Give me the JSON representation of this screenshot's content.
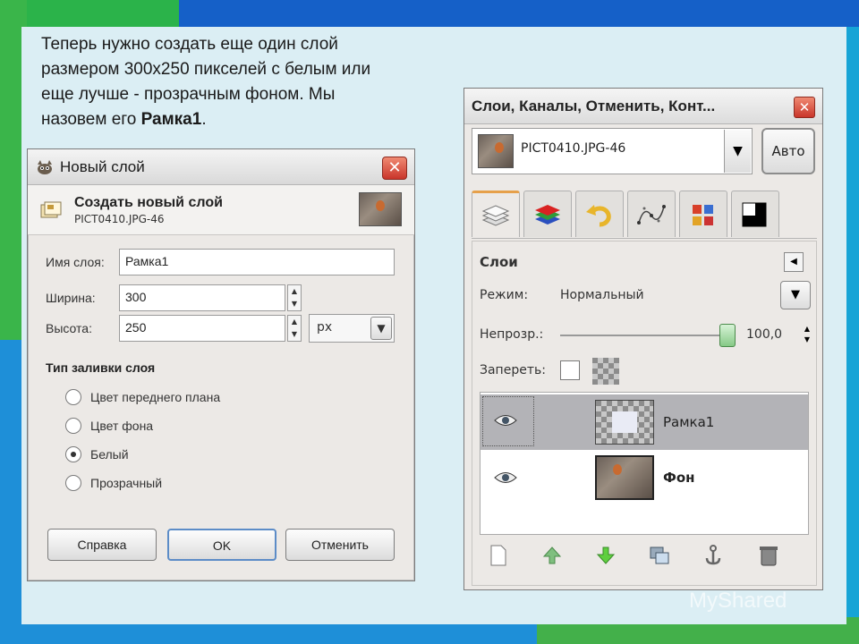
{
  "caption": {
    "line1": "Теперь нужно создать еще один слой",
    "line2": "размером 300x250 пикселей с белым или",
    "line3": "еще лучше - прозрачным фоном. Мы",
    "line4_prefix": "назовем его ",
    "line4_bold": "Рамка1",
    "line4_suffix": "."
  },
  "dialog": {
    "title": "Новый слой",
    "close_glyph": "✕",
    "header_title": "Создать новый слой",
    "header_subtitle": "PICT0410.JPG-46",
    "name_label": "Имя слоя:",
    "name_value": "Рамка1",
    "width_label": "Ширина:",
    "width_value": "300",
    "height_label": "Высота:",
    "height_value": "250",
    "unit_value": "px",
    "fill_section_title": "Тип заливки слоя",
    "fill_options": [
      {
        "label": "Цвет переднего плана",
        "checked": false
      },
      {
        "label": "Цвет фона",
        "checked": false
      },
      {
        "label": "Белый",
        "checked": true
      },
      {
        "label": "Прозрачный",
        "checked": false
      }
    ],
    "help_button": "Справка",
    "ok_button": "OK",
    "cancel_button": "Отменить"
  },
  "panel": {
    "title": "Слои, Каналы, Отменить, Конт...",
    "close_glyph": "✕",
    "image_combo_value": "PICT0410.JPG-46",
    "auto_button": "Авто",
    "section_title": "Слои",
    "mode_label": "Режим:",
    "mode_value": "Нормальный",
    "opacity_label": "Непрозр.:",
    "opacity_value": "100,0",
    "opacity_fraction": 1.0,
    "lock_label": "Запереть:",
    "layers": [
      {
        "name": "Рамка1",
        "selected": true,
        "bold": false
      },
      {
        "name": "Фон",
        "selected": false,
        "bold": true
      }
    ],
    "tab_icons": [
      "layers-icon",
      "channels-icon",
      "undo-icon",
      "paths-icon",
      "colormap-icon",
      "histogram-icon"
    ],
    "toolbar_icons": [
      "new-layer-icon",
      "raise-layer-icon",
      "lower-layer-icon",
      "duplicate-layer-icon",
      "anchor-layer-icon",
      "delete-layer-icon"
    ]
  },
  "watermark": "MyShared",
  "colors": {
    "slide_bg": "#dbeef4",
    "close_red": "#c9352a",
    "tab_accent": "#e6a04a",
    "layer_selected": "#b3b3b7"
  }
}
